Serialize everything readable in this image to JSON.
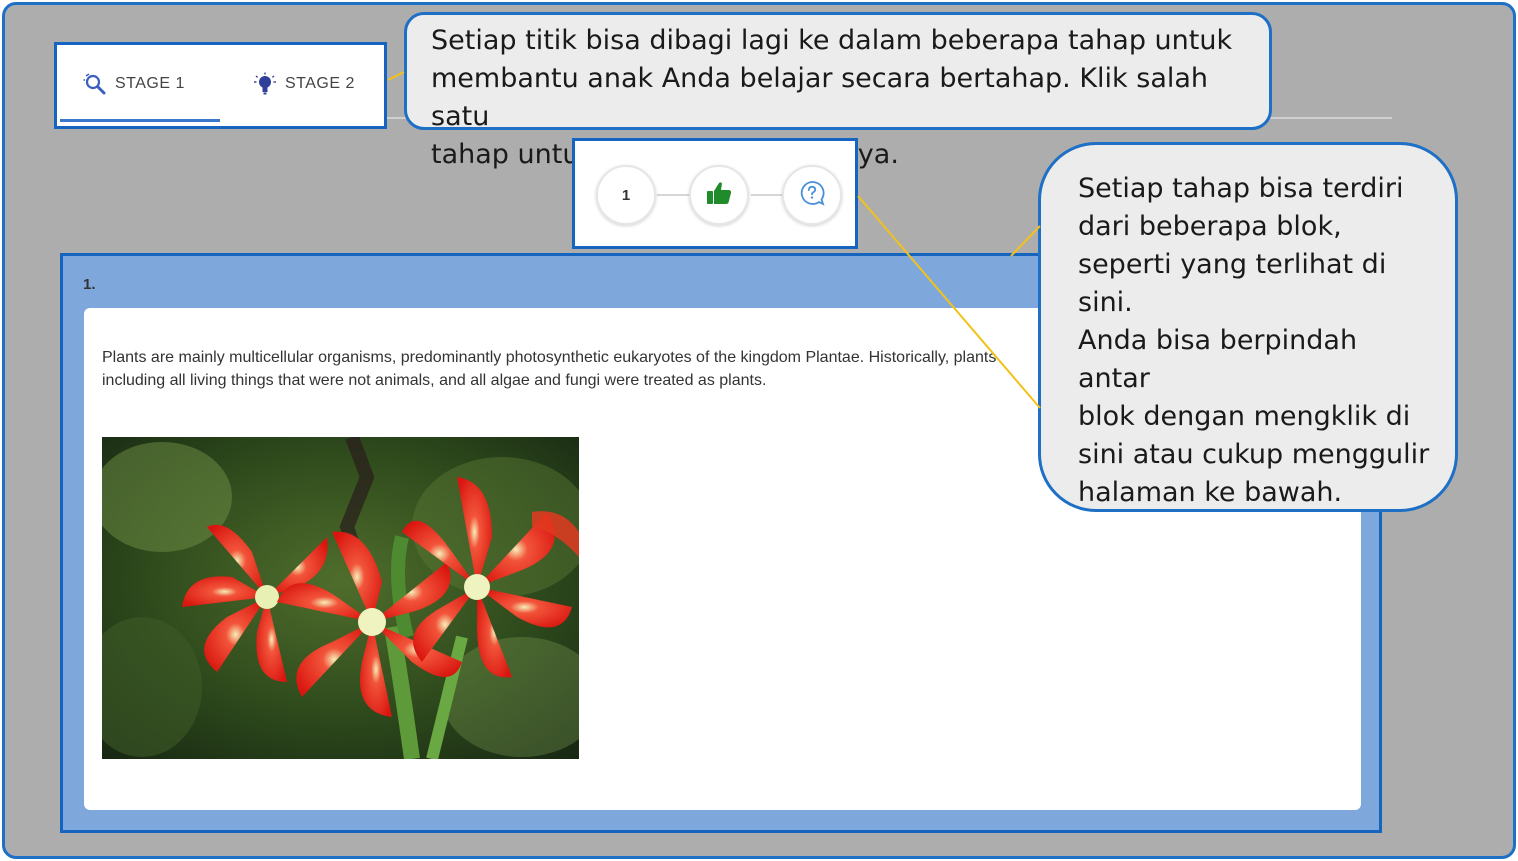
{
  "tabs": [
    {
      "label": "STAGE 1",
      "icon": "magnifier-icon",
      "active": true
    },
    {
      "label": "STAGE 2",
      "icon": "lightbulb-icon",
      "active": false
    }
  ],
  "callouts": {
    "top": {
      "lines": [
        "Setiap titik bisa dibagi lagi ke dalam beberapa tahap untuk",
        "membantu anak Anda belajar secara bertahap. Klik salah satu",
        "tahap untuk melihat isi materinya."
      ]
    },
    "right": {
      "lines": [
        "Setiap tahap bisa terdiri",
        "dari beberapa blok,",
        "seperti yang terlihat di",
        "sini.",
        "Anda bisa berpindah antar",
        "blok dengan mengklik di",
        "sini atau cukup menggulir",
        "halaman ke bawah."
      ]
    }
  },
  "stepper": {
    "steps": [
      {
        "label": "1",
        "icon": null
      },
      {
        "label": "",
        "icon": "thumbs-up-icon"
      },
      {
        "label": "",
        "icon": "question-bubble-icon"
      }
    ]
  },
  "block": {
    "number": "1.",
    "text_line1": "Plants are mainly multicellular organisms, predominantly photosynthetic eukaryotes of the kingdom Plantae. Historically, plants",
    "text_line2": "including all living things that were not animals, and all algae and fungi were treated as plants.",
    "image": "red-amaryllis-flowers-photo"
  },
  "colors": {
    "frame_border": "#1e6fc6",
    "background": "#adadad",
    "block_outer": "#7ea8dc",
    "thumbs_up": "#1f8b2a",
    "question_icon": "#4a90d9",
    "pointer_line": "#f2c21b"
  }
}
